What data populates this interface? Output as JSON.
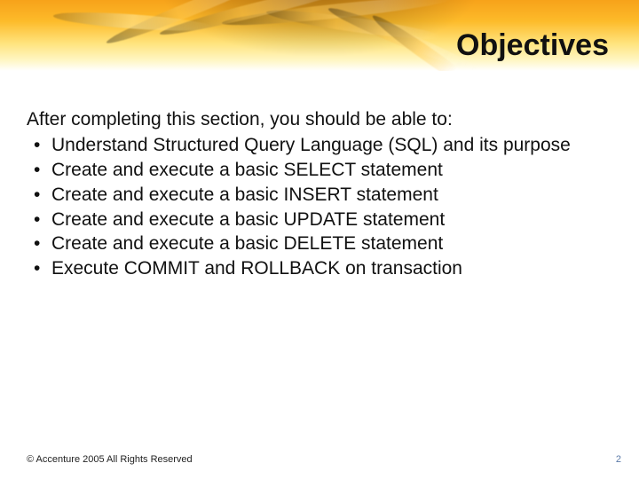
{
  "slide": {
    "title": "Objectives",
    "intro": "After completing this section, you should be able to:",
    "bullets": [
      "Understand Structured Query Language (SQL) and its purpose",
      "Create and execute a basic SELECT statement",
      "Create and execute a basic INSERT statement",
      "Create and execute a basic UPDATE statement",
      "Create and execute a basic DELETE statement",
      "Execute COMMIT and ROLLBACK on transaction"
    ],
    "footer": "© Accenture 2005 All Rights Reserved",
    "page_number": "2"
  }
}
